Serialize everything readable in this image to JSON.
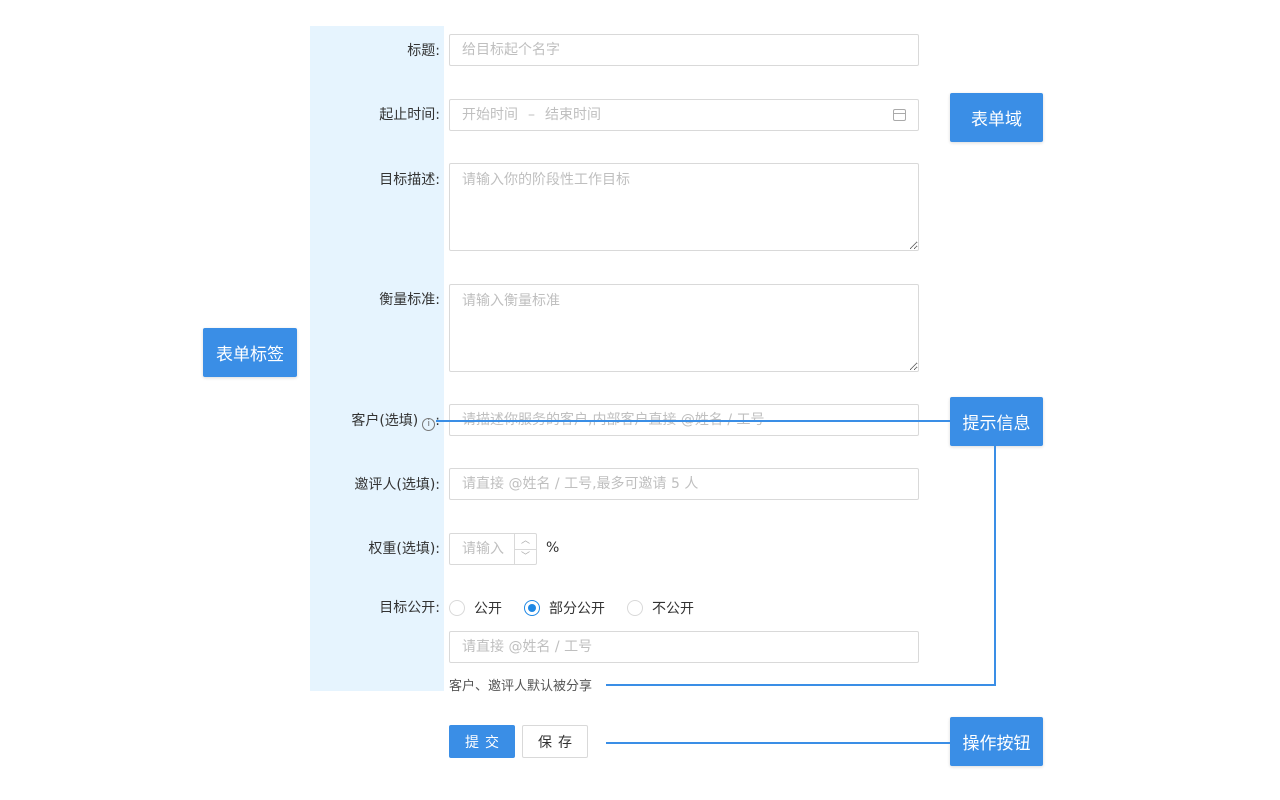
{
  "labels": {
    "title": "标题:",
    "period": "起止时间:",
    "description": "目标描述:",
    "criteria": "衡量标准:",
    "client": "客户(选填)",
    "client_suffix": ":",
    "reviewer": "邀评人(选填):",
    "weight": "权重(选填):",
    "visibility": "目标公开:"
  },
  "placeholders": {
    "title": "给目标起个名字",
    "start": "开始时间",
    "end": "结束时间",
    "description": "请输入你的阶段性工作目标",
    "criteria": "请输入衡量标准",
    "client": "请描述你服务的客户,内部客户直接 @姓名 / 工号",
    "reviewer": "请直接 @姓名 / 工号,最多可邀请 5 人",
    "weight": "请输入",
    "share": "请直接 @姓名 / 工号"
  },
  "range_separator": "–",
  "weight_unit": "%",
  "stepper": {
    "up": "︿",
    "down": "﹀"
  },
  "info_icon": "i",
  "visibility_options": [
    {
      "label": "公开",
      "checked": false
    },
    {
      "label": "部分公开",
      "checked": true
    },
    {
      "label": "不公开",
      "checked": false
    }
  ],
  "helper_text": "客户、邀评人默认被分享",
  "buttons": {
    "submit": "提交",
    "save": "保存"
  },
  "annotations": {
    "form_field": "表单域",
    "form_label": "表单标签",
    "hint": "提示信息",
    "actions": "操作按钮"
  },
  "colors": {
    "accent": "#3a8ee6",
    "label_bg": "#e6f4fe"
  }
}
